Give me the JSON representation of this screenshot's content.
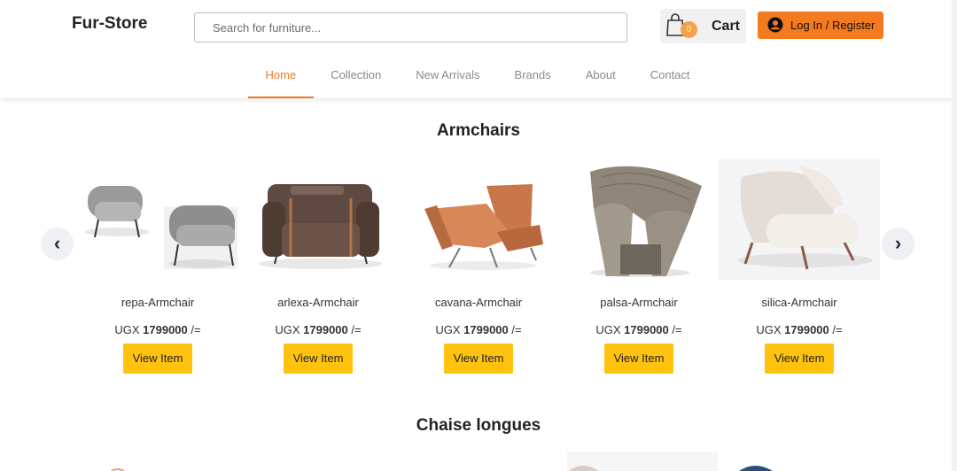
{
  "header": {
    "logo": "Fur-Store",
    "search_placeholder": "Search for furniture...",
    "cart": {
      "count": "0",
      "label": "Cart"
    },
    "login_label": "Log In / Register"
  },
  "nav": {
    "items": [
      "Home",
      "Collection",
      "New Arrivals",
      "Brands",
      "About",
      "Contact"
    ],
    "active": "Home"
  },
  "sections": [
    {
      "title": "Armchairs",
      "products": [
        {
          "name": "repa-Armchair",
          "currency": "UGX",
          "price": "1799000",
          "suffix": "/=",
          "button": "View Item",
          "image": "grey-armchair-pair"
        },
        {
          "name": "arlexa-Armchair",
          "currency": "UGX",
          "price": "1799000",
          "suffix": "/=",
          "button": "View Item",
          "image": "brown-leather-armchair"
        },
        {
          "name": "cavana-Armchair",
          "currency": "UGX",
          "price": "1799000",
          "suffix": "/=",
          "button": "View Item",
          "image": "tan-lounge-chair"
        },
        {
          "name": "palsa-Armchair",
          "currency": "UGX",
          "price": "1799000",
          "suffix": "/=",
          "button": "View Item",
          "image": "grey-quilted-armchair"
        },
        {
          "name": "silica-Armchair",
          "currency": "UGX",
          "price": "1799000",
          "suffix": "/=",
          "button": "View Item",
          "image": "white-shell-armchair"
        }
      ]
    },
    {
      "title": "Chaise longues"
    }
  ],
  "carousel": {
    "prev_icon": "chevron-left-icon",
    "next_icon": "chevron-right-icon",
    "prev": "‹",
    "next": "›"
  },
  "colors": {
    "accent": "#f47a20",
    "button": "#ffc20e",
    "badge": "#f5a04a"
  }
}
